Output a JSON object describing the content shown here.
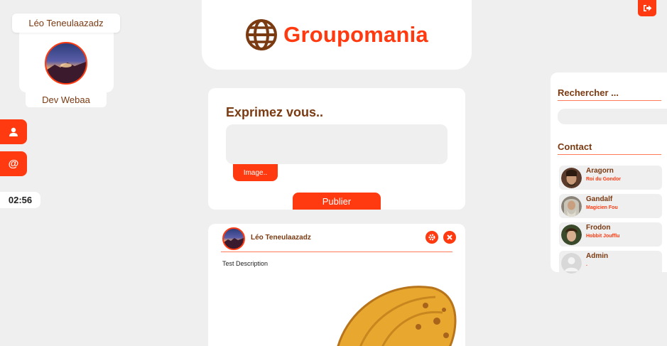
{
  "colors": {
    "accent": "#ff3a10",
    "brown": "#7a3a12",
    "background": "#efefef"
  },
  "header": {
    "logo_text": "Groupomania",
    "logo_icon": "globe-icon"
  },
  "profile": {
    "name": "Léo Teneulaazadz",
    "role": "Dev Webaa"
  },
  "side_nav": [
    {
      "icon": "user-icon",
      "glyph": "👤"
    },
    {
      "icon": "at-sign-icon",
      "glyph": "@"
    }
  ],
  "clock": "02:56",
  "logout": {
    "icon": "logout-icon"
  },
  "post_form": {
    "title": "Exprimez vous..",
    "textarea_value": "",
    "image_button": "Image..",
    "publish_button": "Publier"
  },
  "post": {
    "author": "Léo Teneulaazadz",
    "description": "Test Description",
    "settings_icon": "gear-icon",
    "delete_icon": "close-icon"
  },
  "sidebar": {
    "search_label": "Rechercher ...",
    "search_value": "",
    "contact_label": "Contact",
    "contacts": [
      {
        "name": "Aragorn",
        "subtitle": "Roi du Gondor"
      },
      {
        "name": "Gandalf",
        "subtitle": "Magicien Fou"
      },
      {
        "name": "Frodon",
        "subtitle": "Hobbit Joufflu"
      },
      {
        "name": "Admin",
        "subtitle": "."
      }
    ]
  }
}
